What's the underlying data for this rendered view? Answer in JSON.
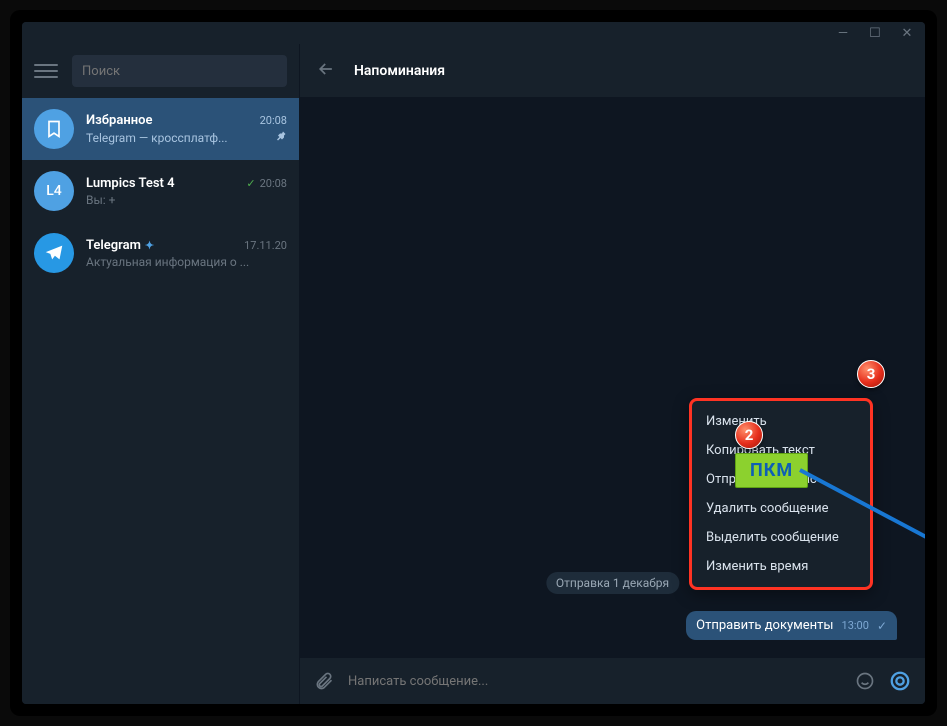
{
  "window_controls": {
    "minimize": "—",
    "maximize": "☐",
    "close": "✕"
  },
  "sidebar": {
    "search_placeholder": "Поиск",
    "chats": [
      {
        "name": "Избранное",
        "time": "20:08",
        "preview": "Telegram — кроссплатф...",
        "pinned": true,
        "avatar": "saved"
      },
      {
        "name": "Lumpics Test 4",
        "time": "20:08",
        "preview": "Вы: +",
        "avatar_text": "L4",
        "checkmark": true
      },
      {
        "name": "Telegram",
        "time": "17.11.20",
        "preview": "Актуальная информация о ...",
        "verified": true,
        "avatar": "tg"
      }
    ]
  },
  "chat": {
    "title": "Напоминания",
    "date_chip": "Отправка 1 декабря",
    "message_text": "Отправить документы",
    "message_time": "13:00",
    "input_placeholder": "Написать сообщение..."
  },
  "context_menu": {
    "items": [
      "Изменить",
      "Копировать текст",
      "Отправить сейчас",
      "Удалить сообщение",
      "Выделить сообщение",
      "Изменить время"
    ]
  },
  "annotations": {
    "badge2": "2",
    "pkm_label": "ПКМ",
    "badge3": "3"
  }
}
